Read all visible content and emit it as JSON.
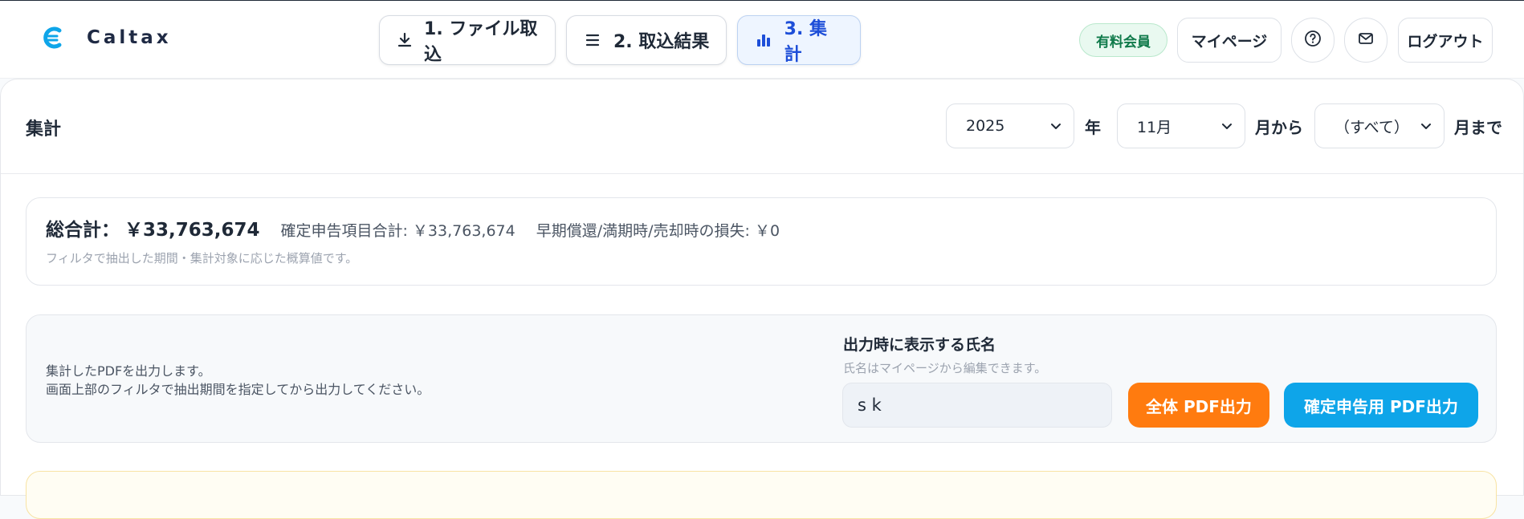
{
  "app": {
    "name": "Caltax"
  },
  "steps": [
    {
      "label": "1. ファイル取込",
      "icon": "download-icon"
    },
    {
      "label": "2. 取込結果",
      "icon": "list-icon"
    },
    {
      "label": "3. 集計",
      "icon": "bar-chart-icon",
      "active": true
    }
  ],
  "nav": {
    "member_badge": "有料会員",
    "mypage_label": "マイページ",
    "logout_label": "ログアウト",
    "help_icon": "help-icon",
    "mail_icon": "mail-icon"
  },
  "card": {
    "title": "集計",
    "filter": {
      "year_value": "2025",
      "year_suffix": "年",
      "from_month_value": "11月",
      "from_suffix": "月から",
      "to_month_value": "（すべて）",
      "to_suffix": "月まで"
    }
  },
  "summary": {
    "total_label": "総合計：",
    "total_value": "￥33,763,674",
    "declared_label": "確定申告項目合計:",
    "declared_value": "￥33,763,674",
    "loss_label": "早期償還/満期時/売却時の損失:",
    "loss_value": "￥0",
    "note": "フィルタで抽出した期間・集計対象に応じた概算値です。"
  },
  "pdf": {
    "desc_line1": "集計したPDFを出力します。",
    "desc_line2": "画面上部のフィルタで抽出期間を指定してから出力してください。",
    "name_title": "出力時に表示する氏名",
    "name_help": "氏名はマイページから編集できます。",
    "name_value": "s k",
    "all_pdf_label": "全体 PDF出力",
    "tax_pdf_label": "確定申告用 PDF出力"
  },
  "colors": {
    "accent_blue": "#1d4ed8",
    "brand_logo": "#0ea5e9",
    "orange_button": "#ff7b0f",
    "blue_button": "#0ea5e9",
    "member_green": "#0f7a4a"
  }
}
